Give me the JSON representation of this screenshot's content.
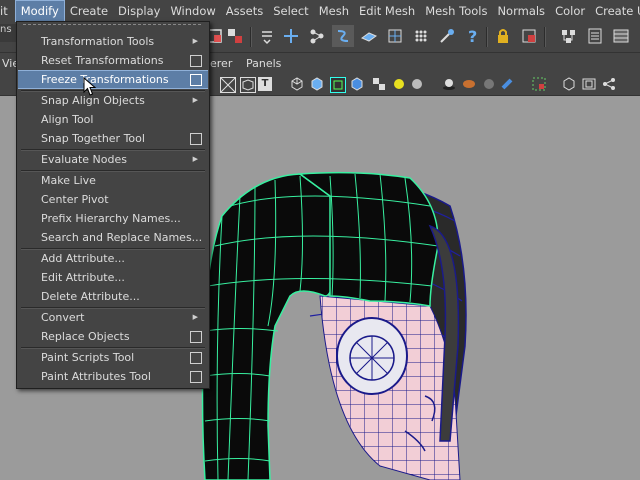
{
  "menubar": {
    "items": [
      "it",
      "Modify",
      "Create",
      "Display",
      "Window",
      "Assets",
      "Select",
      "Mesh",
      "Edit Mesh",
      "Mesh Tools",
      "Normals",
      "Color",
      "Create UVs"
    ],
    "active_index": 1
  },
  "panel_menu": {
    "left_fragment": "Vie",
    "renderer_fragment": "erer",
    "panels": "Panels"
  },
  "left_strip": {
    "top_fragment": "ns"
  },
  "modify_menu": {
    "items": [
      {
        "label": "Transformation Tools",
        "submenu": true
      },
      {
        "label": "Reset Transformations",
        "option_box": true
      },
      {
        "label": "Freeze Transformations",
        "option_box": true,
        "highlighted": true
      },
      {
        "label": "Snap Align Objects",
        "submenu": true
      },
      {
        "label": "Align Tool"
      },
      {
        "label": "Snap Together Tool",
        "option_box": true
      },
      {
        "label": "Evaluate Nodes",
        "submenu": true
      },
      {
        "label": "Make Live"
      },
      {
        "label": "Center Pivot"
      },
      {
        "label": "Prefix Hierarchy Names..."
      },
      {
        "label": "Search and Replace Names..."
      },
      {
        "label": "Add Attribute..."
      },
      {
        "label": "Edit Attribute..."
      },
      {
        "label": "Delete Attribute..."
      },
      {
        "label": "Convert",
        "submenu": true
      },
      {
        "label": "Replace Objects",
        "option_box": true
      },
      {
        "label": "Paint Scripts Tool",
        "option_box": true
      },
      {
        "label": "Paint Attributes Tool",
        "option_box": true
      }
    ]
  },
  "toolbar_icons": [
    "lasso-select-icon",
    "paint-select-icon",
    "snap-grid-icon",
    "snap-curve-icon",
    "snap-point-icon",
    "snap-view-icon",
    "snap-surface-icon",
    "make-live-icon",
    "history-icon",
    "construction-history-icon",
    "render-icon",
    "ipr-icon",
    "render-settings-icon",
    "hypershade-icon",
    "help-icon",
    "lock-icon",
    "select-camera-icon",
    "outliner-icon",
    "attribute-editor-icon",
    "channel-box-icon"
  ],
  "colors": {
    "ui_bg": "#444444",
    "highlight": "#5d7ea6",
    "wireframe_green": "#38f0a0",
    "wireframe_blue": "#18188c",
    "viewport_bg": "#9b9b9b"
  }
}
